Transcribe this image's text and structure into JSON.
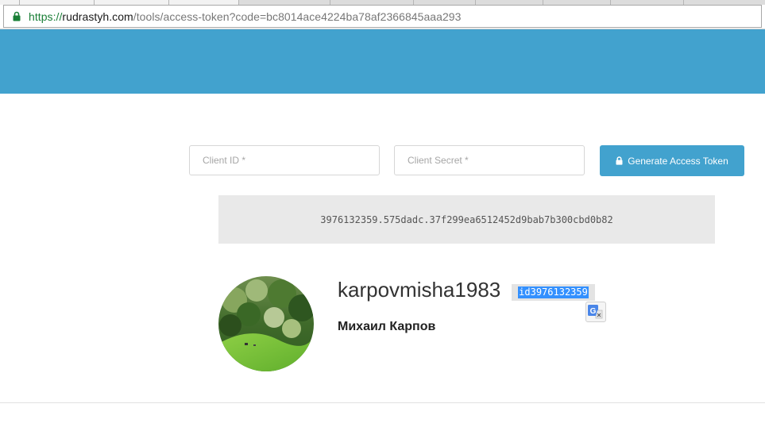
{
  "browser": {
    "url_scheme": "https://",
    "url_host": "rudrastyh.com",
    "url_path": "/tools/access-token?code=bc8014ace4224ba78af2366845aaa293",
    "secure_icon": "lock-icon"
  },
  "form": {
    "client_id_placeholder": "Client ID *",
    "client_secret_placeholder": "Client Secret *",
    "generate_button_label": "Generate Access Token",
    "generate_button_icon": "lock-icon"
  },
  "token": {
    "value": "3976132359.575dadc.37f299ea6512452d9bab7b300cbd0b82"
  },
  "profile": {
    "username": "karpovmisha1983",
    "id_label": "id3976132359",
    "full_name": "Михаил Карпов",
    "avatar_icon": "profile-photo"
  },
  "colors": {
    "accent": "#42a2ce",
    "token_bg": "#e9e9e9",
    "selection": "#3390ff"
  }
}
